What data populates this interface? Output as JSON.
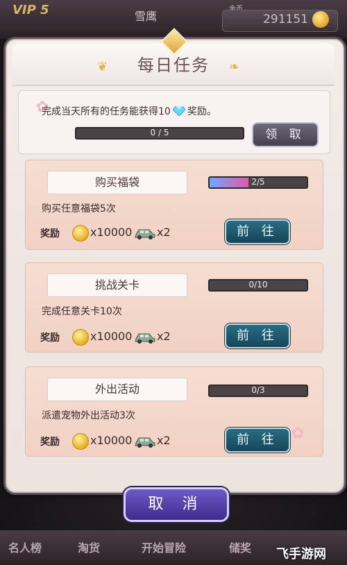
{
  "topbar": {
    "vip": "VIP 5",
    "player_name": "雪鹰",
    "gold_label": "金币",
    "gold_value": "291151"
  },
  "dialog": {
    "title": "每日任务",
    "info_text_before": "完成当天所有的任务能获得10",
    "info_text_after": "奖励。",
    "overall_progress": {
      "text": "0 / 5",
      "fraction": 0
    },
    "claim_label": "领 取",
    "cancel_label": "取 消"
  },
  "tasks": [
    {
      "name": "购买福袋",
      "desc": "购买任意福袋5次",
      "reward_label": "奖励",
      "coin_amount": "x10000",
      "car_amount": "x2",
      "progress_text": "2/5",
      "progress_fraction": 0.4,
      "go_label": "前 往"
    },
    {
      "name": "挑战关卡",
      "desc": "完成任意关卡10次",
      "reward_label": "奖励",
      "coin_amount": "x10000",
      "car_amount": "x2",
      "progress_text": "0/10",
      "progress_fraction": 0,
      "go_label": "前 往"
    },
    {
      "name": "外出活动",
      "desc": "派遣宠物外出活动3次",
      "reward_label": "奖励",
      "coin_amount": "x10000",
      "car_amount": "x2",
      "progress_text": "0/3",
      "progress_fraction": 0,
      "go_label": "前 往"
    }
  ],
  "bottom_nav": {
    "items": [
      "名人榜",
      "淘货",
      "开始冒险",
      "储奖"
    ]
  },
  "watermark": "飞手游网",
  "colors": {
    "go_button": "#1f5870",
    "cancel_button": "#5543b0",
    "progress_fill_start": "#6fa7ff",
    "progress_fill_end": "#d95fb1"
  }
}
